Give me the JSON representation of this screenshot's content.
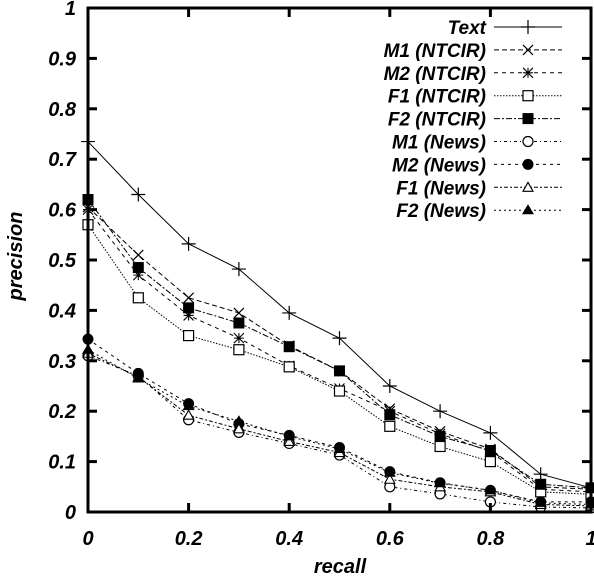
{
  "chart_data": {
    "type": "line",
    "title": "",
    "xlabel": "recall",
    "ylabel": "precision",
    "xlim": [
      0,
      1
    ],
    "ylim": [
      0,
      1
    ],
    "grid": false,
    "legend_position": "top-right",
    "x": [
      0,
      0.1,
      0.2,
      0.3,
      0.4,
      0.5,
      0.6,
      0.7,
      0.8,
      0.9,
      1.0
    ],
    "xticks": [
      "0",
      "0.2",
      "0.4",
      "0.6",
      "0.8",
      "1"
    ],
    "yticks": [
      "0",
      "0.1",
      "0.2",
      "0.3",
      "0.4",
      "0.5",
      "0.6",
      "0.7",
      "0.8",
      "0.9",
      "1"
    ],
    "xtick_values": [
      0,
      0.2,
      0.4,
      0.6,
      0.8,
      1
    ],
    "ytick_values": [
      0,
      0.1,
      0.2,
      0.3,
      0.4,
      0.5,
      0.6,
      0.7,
      0.8,
      0.9,
      1
    ],
    "series": [
      {
        "name": "Text",
        "marker": "plus",
        "dash": "solid",
        "values": [
          0.735,
          0.63,
          0.532,
          0.482,
          0.395,
          0.345,
          0.25,
          0.2,
          0.157,
          0.075,
          0.048
        ]
      },
      {
        "name": "M1 (NTCIR)",
        "marker": "cross",
        "dash": "dashed",
        "values": [
          0.605,
          0.51,
          0.425,
          0.395,
          0.33,
          0.28,
          0.205,
          0.16,
          0.125,
          0.05,
          0.045
        ]
      },
      {
        "name": "M2 (NTCIR)",
        "marker": "star",
        "dash": "dashed-short",
        "values": [
          0.6,
          0.47,
          0.39,
          0.345,
          0.29,
          0.245,
          0.2,
          0.155,
          0.12,
          0.045,
          0.04
        ]
      },
      {
        "name": "F1 (NTCIR)",
        "marker": "square-open",
        "dash": "dotted",
        "values": [
          0.57,
          0.425,
          0.35,
          0.322,
          0.288,
          0.24,
          0.17,
          0.13,
          0.1,
          0.04,
          0.035
        ]
      },
      {
        "name": "F2 (NTCIR)",
        "marker": "square-filled",
        "dash": "dash-dot",
        "values": [
          0.62,
          0.485,
          0.405,
          0.375,
          0.328,
          0.28,
          0.193,
          0.15,
          0.122,
          0.055,
          0.048
        ]
      },
      {
        "name": "M1 (News)",
        "marker": "circle-open",
        "dash": "dash-dot-long",
        "values": [
          0.31,
          0.27,
          0.183,
          0.158,
          0.136,
          0.113,
          0.05,
          0.036,
          0.02,
          0.01,
          0.008
        ]
      },
      {
        "name": "M2 (News)",
        "marker": "circle-filled",
        "dash": "dashed-sparse",
        "values": [
          0.343,
          0.275,
          0.215,
          0.175,
          0.152,
          0.128,
          0.08,
          0.058,
          0.043,
          0.02,
          0.02
        ]
      },
      {
        "name": "F1 (News)",
        "marker": "triangle-open",
        "dash": "dashed-mixed",
        "values": [
          0.315,
          0.268,
          0.192,
          0.165,
          0.14,
          0.118,
          0.065,
          0.05,
          0.04,
          0.015,
          0.012
        ]
      },
      {
        "name": "F2 (News)",
        "marker": "triangle-filled",
        "dash": "dotted-dash",
        "values": [
          0.322,
          0.265,
          0.21,
          0.18,
          0.15,
          0.125,
          0.078,
          0.057,
          0.043,
          0.018,
          0.015
        ]
      }
    ]
  }
}
